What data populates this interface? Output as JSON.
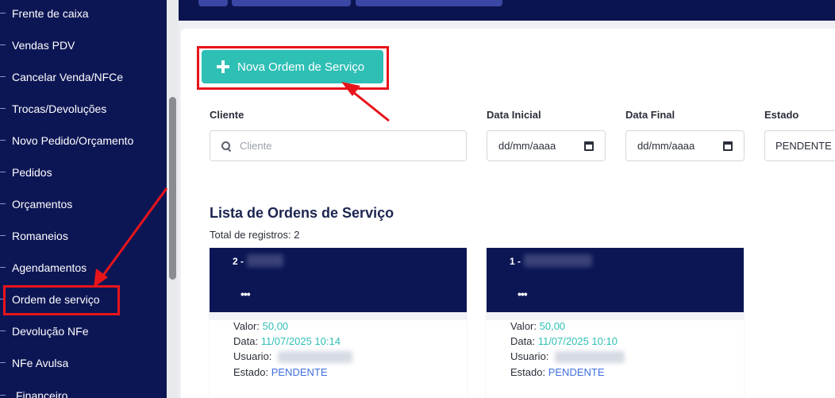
{
  "sidebar": {
    "items": [
      {
        "label": "Frente de caixa"
      },
      {
        "label": "Vendas PDV"
      },
      {
        "label": "Cancelar Venda/NFCe"
      },
      {
        "label": "Trocas/Devoluções"
      },
      {
        "label": "Novo Pedido/Orçamento"
      },
      {
        "label": "Pedidos"
      },
      {
        "label": "Orçamentos"
      },
      {
        "label": "Romaneios"
      },
      {
        "label": "Agendamentos"
      },
      {
        "label": "Ordem de serviço"
      },
      {
        "label": "Devolução NFe"
      },
      {
        "label": "NFe Avulsa"
      },
      {
        "label": "Financeiro"
      }
    ]
  },
  "toolbar": {
    "new_order_label": "Nova Ordem de Serviço"
  },
  "filters": {
    "client_label": "Cliente",
    "client_placeholder": "Cliente",
    "start_date_label": "Data Inicial",
    "start_date_value": "dd/mm/aaaa",
    "end_date_label": "Data Final",
    "end_date_value": "dd/mm/aaaa",
    "state_label": "Estado",
    "state_value": "PENDENTE"
  },
  "list": {
    "title": "Lista de Ordens de Serviço",
    "total": "Total de registros: 2"
  },
  "cards": [
    {
      "number": "2 -",
      "menu": "•••",
      "value_label": "Valor:",
      "value": "50,00",
      "date_label": "Data:",
      "date": "11/07/2025 10:14",
      "user_label": "Usuario:",
      "state_label": "Estado:",
      "state": "PENDENTE"
    },
    {
      "number": "1 -",
      "menu": "•••",
      "value_label": "Valor:",
      "value": "50,00",
      "date_label": "Data:",
      "date": "11/07/2025 10:10",
      "user_label": "Usuario:",
      "state_label": "Estado:",
      "state": "PENDENTE"
    }
  ],
  "colors": {
    "sidebar_bg": "#0d1655",
    "accent_teal": "#2ebfb5",
    "highlight_red": "#e8141b",
    "link_blue": "#3f6fe0"
  }
}
